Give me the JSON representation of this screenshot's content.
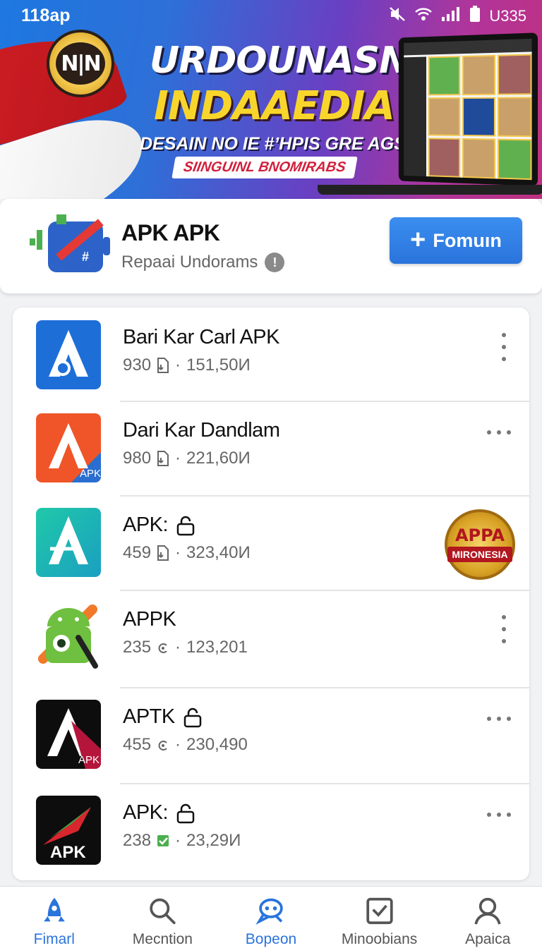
{
  "status_bar": {
    "time": "118ap",
    "battery_label": "U335"
  },
  "banner": {
    "logo_text": "N|N",
    "headline_line1": "URDOUNASN",
    "headline_line2": "INDAAEDIA",
    "headline_line3": "DESAIN NO IE #ʼHPIS GRE AGSH",
    "ribbon": "SIINGUINL BNOMIRABS"
  },
  "header": {
    "title": "APK APK",
    "subtitle": "Repaai Undorams",
    "info_glyph": "!",
    "follow_label": "Fomuın",
    "follow_plus": "+"
  },
  "apps": [
    {
      "name": "Bari Kar Carl APK",
      "rating": "930",
      "downloads": "151,50И",
      "locked": false,
      "menu": "vertical",
      "icon": "blue-a-icon"
    },
    {
      "name": "Dari Kar Dandlam",
      "rating": "980",
      "downloads": "221,60И",
      "locked": false,
      "menu": "horizontal",
      "icon": "orange-a-icon"
    },
    {
      "name": "APK:",
      "rating": "459",
      "downloads": "323,40И",
      "locked": true,
      "menu": "badge",
      "icon": "teal-a-icon"
    },
    {
      "name": "APPK",
      "rating": "235",
      "downloads": "123,201",
      "locked": false,
      "menu": "vertical",
      "icon": "android-icon"
    },
    {
      "name": "APTK",
      "rating": "455",
      "downloads": "230,490",
      "locked": true,
      "menu": "horizontal",
      "icon": "black-a-icon"
    },
    {
      "name": "APK:",
      "rating": "238",
      "downloads": "23,29И",
      "locked": true,
      "menu": "horizontal",
      "icon": "black-apk-icon"
    }
  ],
  "apk_tag": "APK",
  "seal": {
    "line1": "APPA",
    "line2": "MIRONESIA"
  },
  "separator": "·",
  "bottom_nav": [
    {
      "label": "Fimarl",
      "icon": "rocket-icon",
      "active": true
    },
    {
      "label": "Mecntion",
      "icon": "search-icon",
      "active": false
    },
    {
      "label": "Bopeon",
      "icon": "chat-bot-icon",
      "active": true
    },
    {
      "label": "Minoobians",
      "icon": "inbox-icon",
      "active": false
    },
    {
      "label": "Apaica",
      "icon": "profile-icon",
      "active": false
    }
  ],
  "colors": {
    "accent": "#2a74dc",
    "banner_start": "#1d78e0",
    "banner_end": "#c0307f",
    "seal": "#d9a225"
  }
}
